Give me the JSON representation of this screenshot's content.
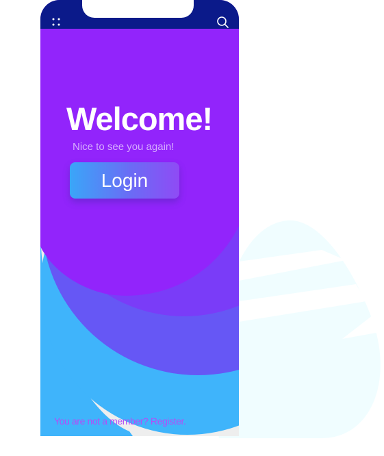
{
  "screen": {
    "title": "Welcome!",
    "subtitle": "Nice to see you again!",
    "login_label": "Login",
    "register_prompt": "You are not a member? ",
    "register_link": "Register."
  },
  "icons": {
    "menu": "menu-dots-icon",
    "search": "search-icon"
  },
  "colors": {
    "status_bar": "#0b1a8a",
    "primary_purple": "#9224fb",
    "wave_violet": "#6d5cf6",
    "wave_blue": "#3fb4fb",
    "cloud": "#f0fdff",
    "link": "#b34df7",
    "footer_bg": "#eeeeee"
  }
}
